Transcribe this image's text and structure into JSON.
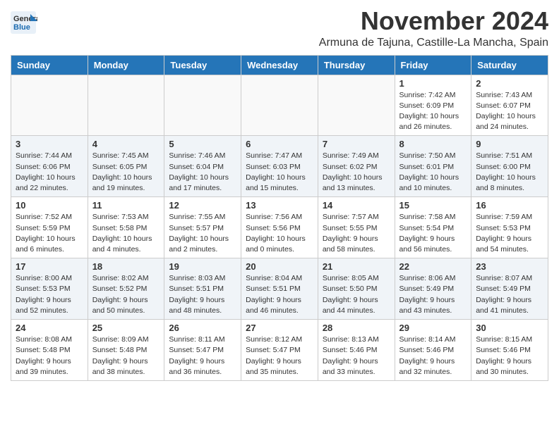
{
  "header": {
    "logo_general": "General",
    "logo_blue": "Blue",
    "title": "November 2024",
    "subtitle": "Armuna de Tajuna, Castille-La Mancha, Spain"
  },
  "calendar": {
    "days_of_week": [
      "Sunday",
      "Monday",
      "Tuesday",
      "Wednesday",
      "Thursday",
      "Friday",
      "Saturday"
    ],
    "weeks": [
      [
        {
          "day": "",
          "info": ""
        },
        {
          "day": "",
          "info": ""
        },
        {
          "day": "",
          "info": ""
        },
        {
          "day": "",
          "info": ""
        },
        {
          "day": "",
          "info": ""
        },
        {
          "day": "1",
          "info": "Sunrise: 7:42 AM\nSunset: 6:09 PM\nDaylight: 10 hours and 26 minutes."
        },
        {
          "day": "2",
          "info": "Sunrise: 7:43 AM\nSunset: 6:07 PM\nDaylight: 10 hours and 24 minutes."
        }
      ],
      [
        {
          "day": "3",
          "info": "Sunrise: 7:44 AM\nSunset: 6:06 PM\nDaylight: 10 hours and 22 minutes."
        },
        {
          "day": "4",
          "info": "Sunrise: 7:45 AM\nSunset: 6:05 PM\nDaylight: 10 hours and 19 minutes."
        },
        {
          "day": "5",
          "info": "Sunrise: 7:46 AM\nSunset: 6:04 PM\nDaylight: 10 hours and 17 minutes."
        },
        {
          "day": "6",
          "info": "Sunrise: 7:47 AM\nSunset: 6:03 PM\nDaylight: 10 hours and 15 minutes."
        },
        {
          "day": "7",
          "info": "Sunrise: 7:49 AM\nSunset: 6:02 PM\nDaylight: 10 hours and 13 minutes."
        },
        {
          "day": "8",
          "info": "Sunrise: 7:50 AM\nSunset: 6:01 PM\nDaylight: 10 hours and 10 minutes."
        },
        {
          "day": "9",
          "info": "Sunrise: 7:51 AM\nSunset: 6:00 PM\nDaylight: 10 hours and 8 minutes."
        }
      ],
      [
        {
          "day": "10",
          "info": "Sunrise: 7:52 AM\nSunset: 5:59 PM\nDaylight: 10 hours and 6 minutes."
        },
        {
          "day": "11",
          "info": "Sunrise: 7:53 AM\nSunset: 5:58 PM\nDaylight: 10 hours and 4 minutes."
        },
        {
          "day": "12",
          "info": "Sunrise: 7:55 AM\nSunset: 5:57 PM\nDaylight: 10 hours and 2 minutes."
        },
        {
          "day": "13",
          "info": "Sunrise: 7:56 AM\nSunset: 5:56 PM\nDaylight: 10 hours and 0 minutes."
        },
        {
          "day": "14",
          "info": "Sunrise: 7:57 AM\nSunset: 5:55 PM\nDaylight: 9 hours and 58 minutes."
        },
        {
          "day": "15",
          "info": "Sunrise: 7:58 AM\nSunset: 5:54 PM\nDaylight: 9 hours and 56 minutes."
        },
        {
          "day": "16",
          "info": "Sunrise: 7:59 AM\nSunset: 5:53 PM\nDaylight: 9 hours and 54 minutes."
        }
      ],
      [
        {
          "day": "17",
          "info": "Sunrise: 8:00 AM\nSunset: 5:53 PM\nDaylight: 9 hours and 52 minutes."
        },
        {
          "day": "18",
          "info": "Sunrise: 8:02 AM\nSunset: 5:52 PM\nDaylight: 9 hours and 50 minutes."
        },
        {
          "day": "19",
          "info": "Sunrise: 8:03 AM\nSunset: 5:51 PM\nDaylight: 9 hours and 48 minutes."
        },
        {
          "day": "20",
          "info": "Sunrise: 8:04 AM\nSunset: 5:51 PM\nDaylight: 9 hours and 46 minutes."
        },
        {
          "day": "21",
          "info": "Sunrise: 8:05 AM\nSunset: 5:50 PM\nDaylight: 9 hours and 44 minutes."
        },
        {
          "day": "22",
          "info": "Sunrise: 8:06 AM\nSunset: 5:49 PM\nDaylight: 9 hours and 43 minutes."
        },
        {
          "day": "23",
          "info": "Sunrise: 8:07 AM\nSunset: 5:49 PM\nDaylight: 9 hours and 41 minutes."
        }
      ],
      [
        {
          "day": "24",
          "info": "Sunrise: 8:08 AM\nSunset: 5:48 PM\nDaylight: 9 hours and 39 minutes."
        },
        {
          "day": "25",
          "info": "Sunrise: 8:09 AM\nSunset: 5:48 PM\nDaylight: 9 hours and 38 minutes."
        },
        {
          "day": "26",
          "info": "Sunrise: 8:11 AM\nSunset: 5:47 PM\nDaylight: 9 hours and 36 minutes."
        },
        {
          "day": "27",
          "info": "Sunrise: 8:12 AM\nSunset: 5:47 PM\nDaylight: 9 hours and 35 minutes."
        },
        {
          "day": "28",
          "info": "Sunrise: 8:13 AM\nSunset: 5:46 PM\nDaylight: 9 hours and 33 minutes."
        },
        {
          "day": "29",
          "info": "Sunrise: 8:14 AM\nSunset: 5:46 PM\nDaylight: 9 hours and 32 minutes."
        },
        {
          "day": "30",
          "info": "Sunrise: 8:15 AM\nSunset: 5:46 PM\nDaylight: 9 hours and 30 minutes."
        }
      ]
    ]
  }
}
